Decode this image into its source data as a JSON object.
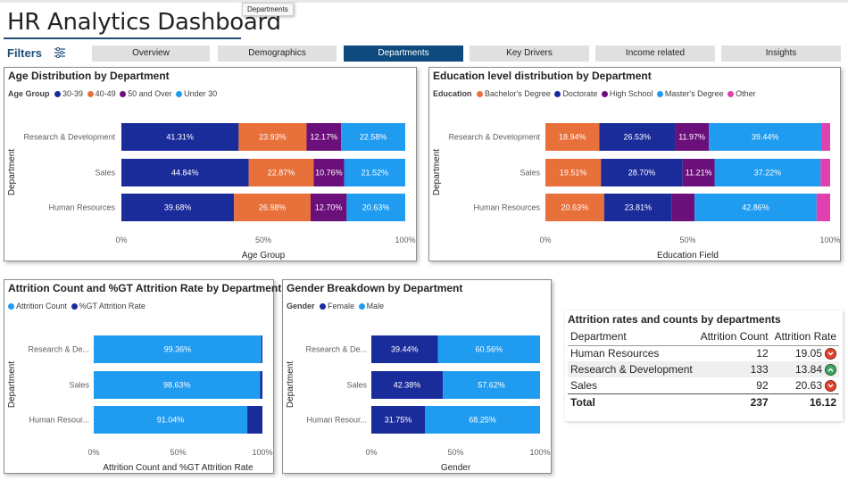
{
  "header": {
    "title": "HR Analytics Dashboard",
    "tooltip": "Departments",
    "filters_label": "Filters"
  },
  "tabs": [
    {
      "label": "Overview",
      "active": false
    },
    {
      "label": "Demographics",
      "active": false
    },
    {
      "label": "Departments",
      "active": true
    },
    {
      "label": "Key Drivers",
      "active": false
    },
    {
      "label": "Income related",
      "active": false
    },
    {
      "label": "Insights",
      "active": false
    }
  ],
  "colors": {
    "navy": "#1a2b9a",
    "orange": "#e8703a",
    "purple": "#6b0f7a",
    "lightblue": "#1f9bf0",
    "pink": "#e040b0",
    "active_tab": "#0e4a7e"
  },
  "age_panel": {
    "title": "Age Distribution by Department",
    "legend_title": "Age Group",
    "legend": [
      "30-39",
      "40-49",
      "50 and Over",
      "Under 30"
    ]
  },
  "edu_panel": {
    "title": "Education level distribution by Department",
    "legend_title": "Education",
    "legend": [
      "Bachelor's Degree",
      "Doctorate",
      "High School",
      "Master's Degree",
      "Other"
    ]
  },
  "attr_panel": {
    "title": "Attrition Count and %GT Attrition Rate by Department",
    "legend": [
      "Attrition Count",
      "%GT Attrition Rate"
    ]
  },
  "gender_panel": {
    "title": "Gender Breakdown by Department",
    "legend_title": "Gender",
    "legend": [
      "Female",
      "Male"
    ]
  },
  "chart_data": [
    {
      "type": "bar",
      "orientation": "horizontal-stacked-100",
      "title": "Age Distribution by Department",
      "categories": [
        "Research & Development",
        "Sales",
        "Human Resources"
      ],
      "xlabel": "Age Group",
      "ylabel": "Department",
      "xticks": [
        "0%",
        "50%",
        "100%"
      ],
      "series": [
        {
          "name": "30-39",
          "color": "#1a2b9a",
          "values": [
            41.31,
            44.84,
            39.68
          ],
          "labels": [
            "41.31%",
            "44.84%",
            "39.68%"
          ]
        },
        {
          "name": "40-49",
          "color": "#e8703a",
          "values": [
            23.93,
            22.87,
            26.98
          ],
          "labels": [
            "23.93%",
            "22.87%",
            "26.98%"
          ]
        },
        {
          "name": "50 and Over",
          "color": "#6b0f7a",
          "values": [
            12.17,
            10.76,
            12.7
          ],
          "labels": [
            "12.17%",
            "10.76%",
            "12.70%"
          ]
        },
        {
          "name": "Under 30",
          "color": "#1f9bf0",
          "values": [
            22.58,
            21.52,
            20.63
          ],
          "labels": [
            "22.58%",
            "21.52%",
            "20.63%"
          ]
        }
      ]
    },
    {
      "type": "bar",
      "orientation": "horizontal-stacked-100",
      "title": "Education level distribution by Department",
      "categories": [
        "Research & Development",
        "Sales",
        "Human Resources"
      ],
      "xlabel": "Education Field",
      "ylabel": "Department",
      "xticks": [
        "0%",
        "50%",
        "100%"
      ],
      "series": [
        {
          "name": "Bachelor's Degree",
          "color": "#e8703a",
          "values": [
            18.94,
            19.51,
            20.63
          ],
          "labels": [
            "18.94%",
            "19.51%",
            "20.63%"
          ]
        },
        {
          "name": "Doctorate",
          "color": "#1a2b9a",
          "values": [
            26.53,
            28.7,
            23.81
          ],
          "labels": [
            "26.53%",
            "28.70%",
            "23.81%"
          ]
        },
        {
          "name": "High School",
          "color": "#6b0f7a",
          "values": [
            11.97,
            11.21,
            7.94
          ],
          "labels": [
            "11.97%",
            "11.21%",
            ""
          ]
        },
        {
          "name": "Master's Degree",
          "color": "#1f9bf0",
          "values": [
            39.44,
            37.22,
            42.86
          ],
          "labels": [
            "39.44%",
            "37.22%",
            "42.86%"
          ]
        },
        {
          "name": "Other",
          "color": "#e040b0",
          "values": [
            3.12,
            3.36,
            4.76
          ],
          "labels": [
            "",
            "",
            ""
          ]
        }
      ]
    },
    {
      "type": "bar",
      "orientation": "horizontal-stacked-100",
      "title": "Attrition Count and %GT Attrition Rate by Department",
      "categories": [
        "Research & De...",
        "Sales",
        "Human Resour..."
      ],
      "xlabel": "Attrition Count and %GT Attrition Rate",
      "ylabel": "Department",
      "xticks": [
        "0%",
        "50%",
        "100%"
      ],
      "series": [
        {
          "name": "Attrition Count",
          "color": "#1f9bf0",
          "values": [
            99.36,
            98.63,
            91.04
          ],
          "labels": [
            "99.36%",
            "98.63%",
            "91.04%"
          ]
        },
        {
          "name": "%GT Attrition Rate",
          "color": "#1a2b9a",
          "values": [
            0.64,
            1.37,
            8.96
          ],
          "labels": [
            "",
            "",
            ""
          ]
        }
      ]
    },
    {
      "type": "bar",
      "orientation": "horizontal-stacked-100",
      "title": "Gender Breakdown by Department",
      "categories": [
        "Research & De...",
        "Sales",
        "Human Resour..."
      ],
      "xlabel": "Gender",
      "ylabel": "Department",
      "xticks": [
        "0%",
        "50%",
        "100%"
      ],
      "series": [
        {
          "name": "Female",
          "color": "#1a2b9a",
          "values": [
            39.44,
            42.38,
            31.75
          ],
          "labels": [
            "39.44%",
            "42.38%",
            "31.75%"
          ]
        },
        {
          "name": "Male",
          "color": "#1f9bf0",
          "values": [
            60.56,
            57.62,
            68.25
          ],
          "labels": [
            "60.56%",
            "57.62%",
            "68.25%"
          ]
        }
      ]
    },
    {
      "type": "table",
      "title": "Attrition rates and counts by departments",
      "columns": [
        "Department",
        "Attrition Count",
        "Attrition Rate"
      ],
      "rows": [
        {
          "department": "Human Resources",
          "count": "12",
          "rate": "19.05",
          "status": "bad"
        },
        {
          "department": "Research & Development",
          "count": "133",
          "rate": "13.84",
          "status": "good"
        },
        {
          "department": "Sales",
          "count": "92",
          "rate": "20.63",
          "status": "bad"
        }
      ],
      "total": {
        "label": "Total",
        "count": "237",
        "rate": "16.12"
      }
    }
  ]
}
